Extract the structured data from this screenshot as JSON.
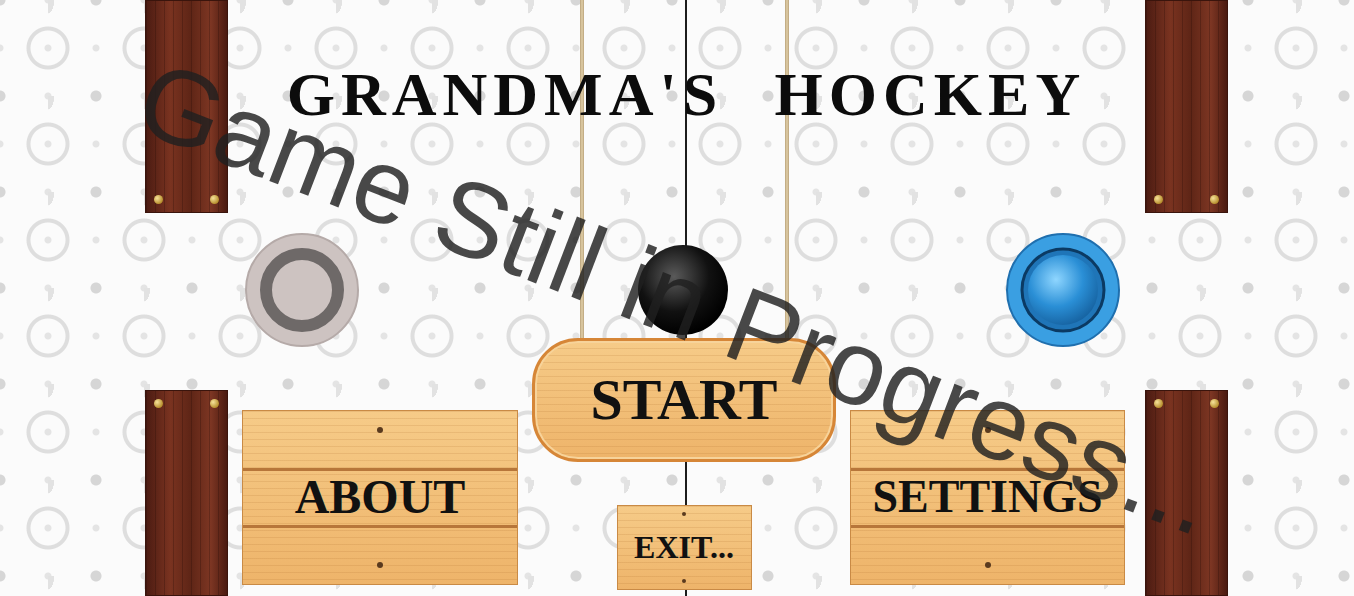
{
  "title": "GRANDMA'S HOCKEY",
  "menu": [
    {
      "label": "START",
      "kind": "pill"
    },
    {
      "label": "ABOUT",
      "kind": "plank"
    },
    {
      "label": "SETTINGS",
      "kind": "plank"
    },
    {
      "label": "EXIT...",
      "kind": "small"
    }
  ],
  "watermark": "Game Still in Progress..."
}
